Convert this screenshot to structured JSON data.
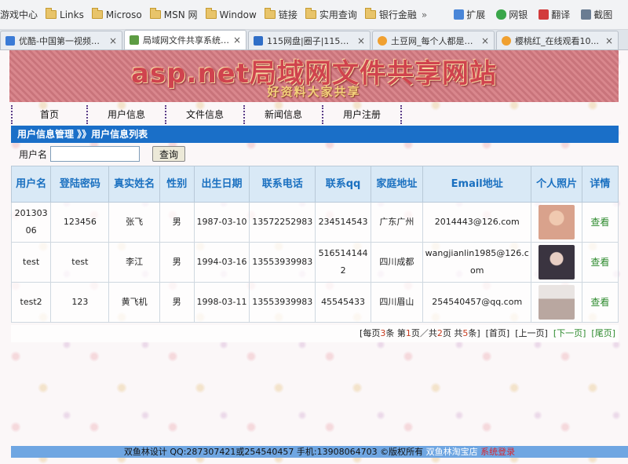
{
  "favorites": {
    "items": [
      "游戏中心",
      "Links",
      "Microso",
      "MSN 网",
      "Window",
      "链接",
      "实用查询",
      "银行金融"
    ],
    "more": "»",
    "tools": [
      "扩展",
      "网银",
      "翻译",
      "截图"
    ]
  },
  "tabs": [
    {
      "label": "优酷-中国第一视频网...",
      "active": false,
      "icon_color": "#3b7bd6"
    },
    {
      "label": "局域网文件共享系统-...",
      "active": true,
      "icon_color": "#5d9c43"
    },
    {
      "label": "115网盘|圈子|115，...",
      "active": false,
      "icon_color": "#2f6ec7"
    },
    {
      "label": "土豆网_每个人都是生...",
      "active": false,
      "icon_color": "#f0a030"
    },
    {
      "label": "樱桃红_在线观看10...",
      "active": false,
      "icon_color": "#f0a030"
    }
  ],
  "banner": {
    "title": "asp.net局域网文件共享网站",
    "subtitle": "好资料大家共享"
  },
  "nav": [
    "首页",
    "用户信息",
    "文件信息",
    "新闻信息",
    "用户注册"
  ],
  "breadcrumb": "用户信息管理 》》用户信息列表",
  "search": {
    "label": "用户名",
    "value": "",
    "button": "查询"
  },
  "table": {
    "headers": [
      "用户名",
      "登陆密码",
      "真实姓名",
      "性别",
      "出生日期",
      "联系电话",
      "联系qq",
      "家庭地址",
      "Email地址",
      "个人照片",
      "详情"
    ],
    "rows": [
      {
        "username": "20130306",
        "password": "123456",
        "realname": "张飞",
        "gender": "男",
        "birth": "1987-03-10",
        "phone": "13572252983",
        "qq": "234514543",
        "address": "广东广州",
        "email": "2014443@126.com",
        "photo_color": "#d9a28c",
        "detail": "查看"
      },
      {
        "username": "test",
        "password": "test",
        "realname": "李江",
        "gender": "男",
        "birth": "1994-03-16",
        "phone": "13553939983",
        "qq": "5165141442",
        "address": "四川成都",
        "email": "wangjianlin1985@126.com",
        "photo_color": "#3a3440",
        "detail": "查看"
      },
      {
        "username": "test2",
        "password": "123",
        "realname": "黄飞机",
        "gender": "男",
        "birth": "1998-03-11",
        "phone": "13553939983",
        "qq": "45545433",
        "address": "四川眉山",
        "email": "254540457@qq.com",
        "photo_color": "#b9a7a0",
        "detail": "查看"
      }
    ]
  },
  "pager": {
    "prefix": "[每页",
    "per_page": "3",
    "mid1": "条 第",
    "page": "1",
    "mid2": "页／共",
    "pages": "2",
    "mid3": "页 共",
    "total": "5",
    "suffix": "条]",
    "first": "[首页]",
    "prev": "[上一页]",
    "next": "[下一页]",
    "last": "[尾页]"
  },
  "footer": {
    "text": "双鱼林设计 QQ:287307421或254540457 手机:13908064703 ©版权所有",
    "link1": "双鱼林淘宝店",
    "link2": "系统登录"
  }
}
